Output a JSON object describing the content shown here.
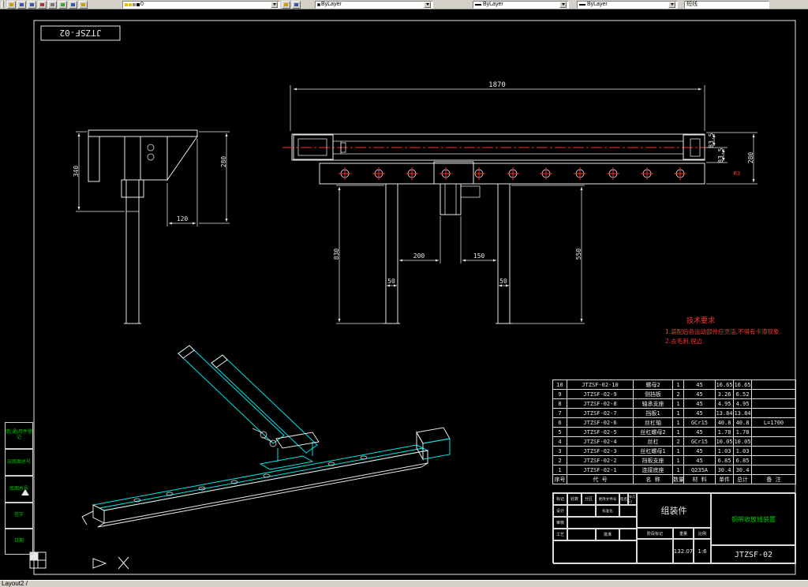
{
  "toolbar": {
    "layer_combo_value": "0",
    "color_combo_value": "ByLayer",
    "linetype_combo_value": "ByLayer",
    "lineweight_combo_value": "ByLayer",
    "right_field_value": "短线"
  },
  "statusbar": {
    "tab_label": "Layout2 /"
  },
  "drawing": {
    "sheet_label": "JTZSF-02",
    "dims": {
      "top_length": "1870",
      "right_offset_a": "83.5",
      "right_offset_b": "83.5",
      "right_height": "280",
      "fillet": "R3",
      "left_height": "340",
      "left_height2": "280",
      "left_width": "120",
      "leg_height": "830",
      "span_a": "200",
      "span_b": "150",
      "leg_width_a": "50",
      "leg_width_b": "50",
      "leg_height2": "550"
    },
    "tech_req": {
      "title": "技术要求",
      "line1": "1.装配后各运动部件应灵活,不得有卡滞现象.",
      "line2": "2.去毛刺,锐边."
    },
    "bom": {
      "header": {
        "no": "序号",
        "code": "代 号",
        "name": "名 称",
        "qty": "数量",
        "mat": "材 料",
        "w_unit": "单件",
        "w_total": "总计",
        "note": "备 注"
      },
      "rows": [
        {
          "no": "10",
          "code": "JTZSF-02-10",
          "name": "螺母2",
          "qty": "1",
          "mat": "45",
          "w1": "16.65",
          "w2": "16.65",
          "note": ""
        },
        {
          "no": "9",
          "code": "JTZSF-02-9",
          "name": "侧挡板",
          "qty": "2",
          "mat": "45",
          "w1": "3.26",
          "w2": "6.52",
          "note": ""
        },
        {
          "no": "8",
          "code": "JTZSF-02-8",
          "name": "轴承支座",
          "qty": "1",
          "mat": "45",
          "w1": "4.95",
          "w2": "4.95",
          "note": ""
        },
        {
          "no": "7",
          "code": "JTZSF-02-7",
          "name": "挡板1",
          "qty": "1",
          "mat": "45",
          "w1": "13.84",
          "w2": "13.84",
          "note": ""
        },
        {
          "no": "6",
          "code": "JTZSF-02-6",
          "name": "丝杠轴",
          "qty": "1",
          "mat": "GCr15",
          "w1": "40.8",
          "w2": "40.8",
          "note": "L=1700"
        },
        {
          "no": "5",
          "code": "JTZSF-02-5",
          "name": "丝杠螺母2",
          "qty": "1",
          "mat": "45",
          "w1": "1.78",
          "w2": "1.78",
          "note": ""
        },
        {
          "no": "4",
          "code": "JTZSF-02-4",
          "name": "丝杠",
          "qty": "2",
          "mat": "GCr15",
          "w1": "10.05",
          "w2": "10.05",
          "note": ""
        },
        {
          "no": "3",
          "code": "JTZSF-02-3",
          "name": "丝杠螺母1",
          "qty": "1",
          "mat": "45",
          "w1": "1.03",
          "w2": "1.03",
          "note": ""
        },
        {
          "no": "2",
          "code": "JTZSF-02-2",
          "name": "挡板支座",
          "qty": "1",
          "mat": "45",
          "w1": "6.85",
          "w2": "6.85",
          "note": ""
        },
        {
          "no": "1",
          "code": "JTZSF-02-1",
          "name": "连接底座",
          "qty": "1",
          "mat": "Q235A",
          "w1": "30.4",
          "w2": "30.4",
          "note": ""
        }
      ]
    },
    "titleblock": {
      "part_name": "组装件",
      "drawing_no": "JTZSF-02",
      "project_name": "铜带收放线装置",
      "weight_value": "132.07",
      "scale_value": "1:6",
      "labels": {
        "mark": "标记",
        "count": "处数",
        "zone": "分区",
        "doc": "更改文件号",
        "sign": "签名",
        "date": "年月日",
        "design": "设计",
        "standard": "标准化",
        "audit": "审核",
        "craft": "工艺",
        "approve": "批准",
        "stage": "阶段标记",
        "weight": "重量",
        "scale": "比例"
      }
    },
    "margin_blocks": [
      "借(通)用件登记",
      "旧底图总号",
      "底图总号",
      "签字",
      "日期"
    ]
  }
}
